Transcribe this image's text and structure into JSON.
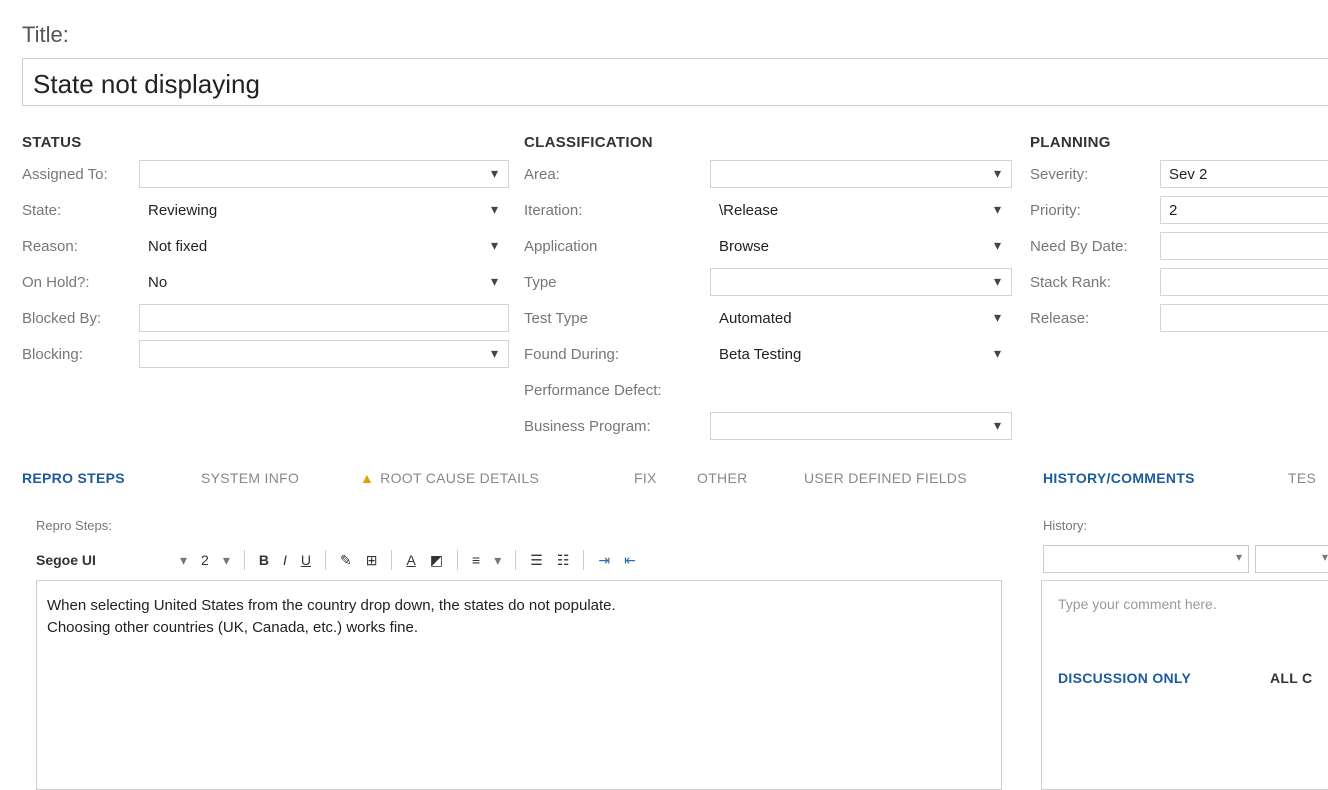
{
  "title": {
    "label": "Title:",
    "value": "State not displaying"
  },
  "status": {
    "heading": "STATUS",
    "fields": [
      {
        "label": "Assigned To:",
        "value": ""
      },
      {
        "label": "State:",
        "value": "Reviewing"
      },
      {
        "label": "Reason:",
        "value": "Not fixed"
      },
      {
        "label": "On Hold?:",
        "value": "No"
      },
      {
        "label": "Blocked By:",
        "value": ""
      },
      {
        "label": "Blocking:",
        "value": ""
      }
    ]
  },
  "classification": {
    "heading": "CLASSIFICATION",
    "fields": [
      {
        "label": "Area:",
        "value": ""
      },
      {
        "label": "Iteration:",
        "value": "\\Release"
      },
      {
        "label": "Application",
        "value": "Browse"
      },
      {
        "label": "Type",
        "value": ""
      },
      {
        "label": "Test Type",
        "value": "Automated"
      },
      {
        "label": "Found During:",
        "value": "Beta Testing"
      },
      {
        "label": "Performance Defect:",
        "value": ""
      },
      {
        "label": "Business Program:",
        "value": ""
      }
    ]
  },
  "planning": {
    "heading": "PLANNING",
    "fields": [
      {
        "label": "Severity:",
        "value": "Sev 2"
      },
      {
        "label": "Priority:",
        "value": "2"
      },
      {
        "label": "Need By Date:",
        "value": ""
      },
      {
        "label": "Stack Rank:",
        "value": ""
      },
      {
        "label": "Release:",
        "value": ""
      }
    ]
  },
  "tabs": [
    {
      "label": "REPRO STEPS"
    },
    {
      "label": "SYSTEM INFO"
    },
    {
      "label": "ROOT CAUSE DETAILS"
    },
    {
      "label": "FIX"
    },
    {
      "label": "OTHER"
    },
    {
      "label": "USER DEFINED FIELDS"
    }
  ],
  "right_tabs": [
    {
      "label": "HISTORY/COMMENTS"
    },
    {
      "label": "TES"
    }
  ],
  "repro": {
    "label": "Repro Steps:",
    "font": "Segoe UI",
    "size": "2",
    "text_line1": "When selecting United States from the country drop down, the states do not populate.",
    "text_line2": "Choosing other countries (UK, Canada, etc.) works fine."
  },
  "history": {
    "label": "History:",
    "placeholder": "Type your comment here.",
    "tab_discussion": "DISCUSSION ONLY",
    "tab_all": "ALL C"
  },
  "colors": {
    "accent": "#1c5b9c",
    "warning": "#e0a000"
  },
  "icons": [
    "warning-icon",
    "bold-icon",
    "italic-icon",
    "underline-icon",
    "highlight-icon",
    "table-icon",
    "font-color-icon",
    "format-painter-icon",
    "align-icon",
    "bullet-list-icon",
    "numbered-list-icon",
    "indent-icon",
    "outdent-icon",
    "dropdown-icon"
  ]
}
